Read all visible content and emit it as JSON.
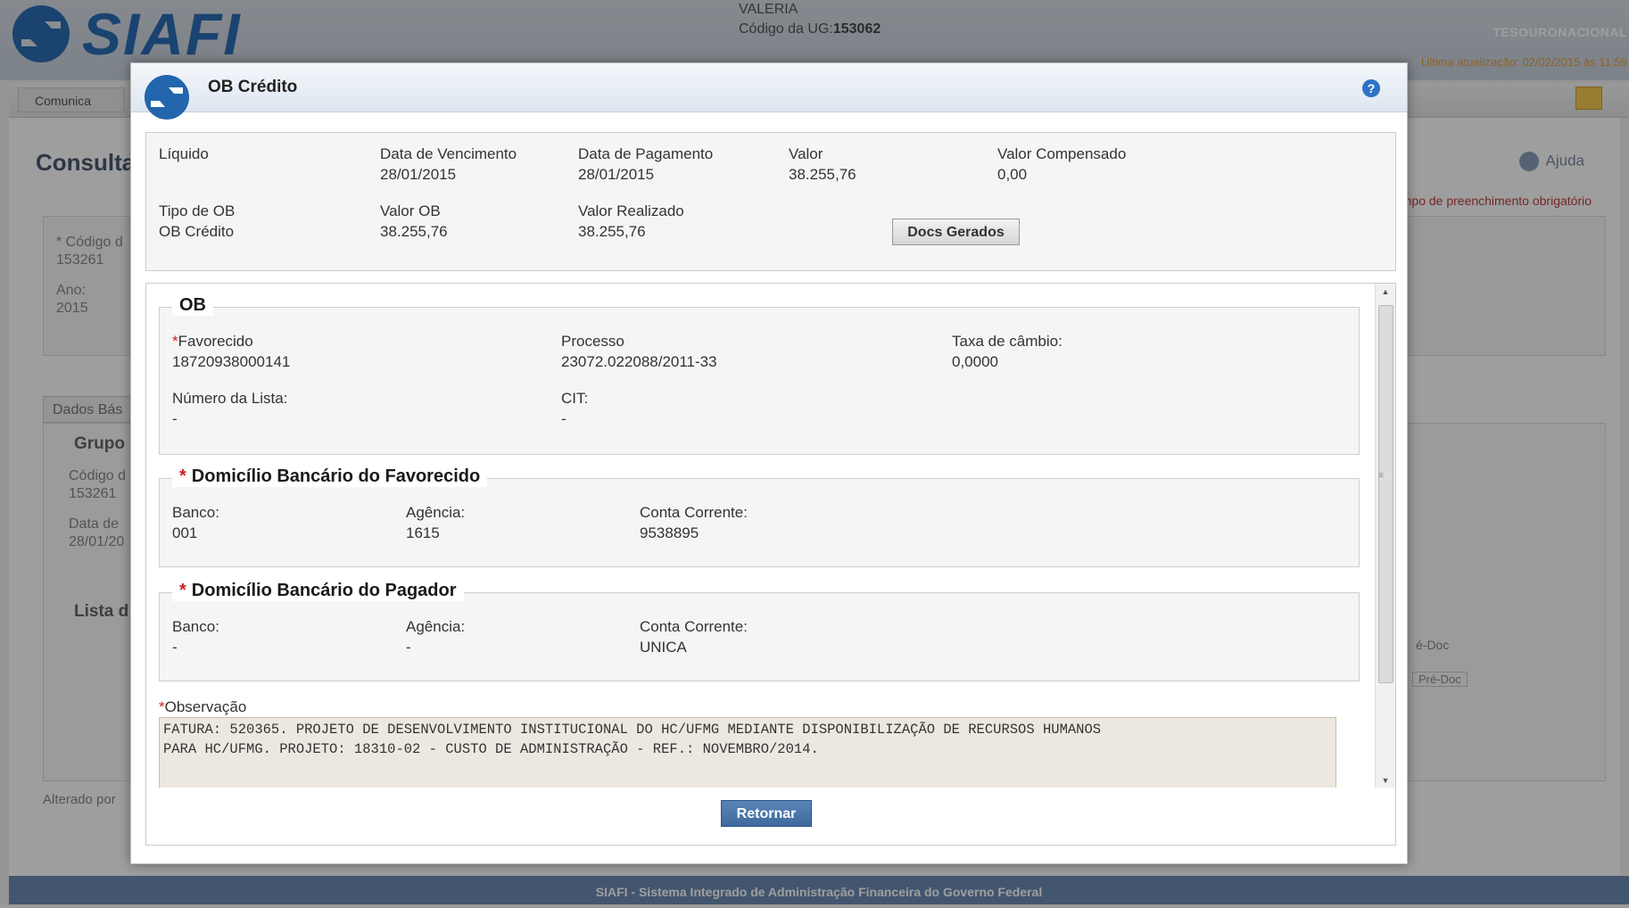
{
  "background": {
    "logo_text": "SIAFI",
    "user_name": "VALERIA",
    "ug_label": "Código da UG:",
    "ug_value": "153062",
    "tesouro": "TESOURONACIONAL",
    "last_update": "Última atualização: 02/02/2015 às 11:59",
    "tab_comunica": "Comunica",
    "page_title": "Consulta",
    "help_label": "Ajuda",
    "required_note": "Campo de preenchimento obrigatório",
    "codigo_label": "* Código d",
    "codigo_value": "153261",
    "ano_label": "Ano:",
    "ano_value": "2015",
    "tab_dados": "Dados Bás",
    "grupo_title": "Grupo",
    "grupo_codigo_label": "Código d",
    "grupo_codigo_value": "153261",
    "data_label": "Data de",
    "data_value": "28/01/20",
    "lista_title": "Lista d",
    "pre_doc_header": "é-Doc",
    "pre_doc_btn": "Pré-Doc",
    "alterado_por": "Alterado por",
    "footer": "SIAFI - Sistema Integrado de Administração Financeira do Governo Federal"
  },
  "modal": {
    "title": "OB Crédito",
    "help_icon_glyph": "?",
    "summary": {
      "liquido_label": "Líquido",
      "vencimento_label": "Data de Vencimento",
      "vencimento_value": "28/01/2015",
      "pagamento_label": "Data de Pagamento",
      "pagamento_value": "28/01/2015",
      "valor_label": "Valor",
      "valor_value": "38.255,76",
      "compensado_label": "Valor Compensado",
      "compensado_value": "0,00",
      "tipo_label": "Tipo de OB",
      "tipo_value": "OB Crédito",
      "valor_ob_label": "Valor OB",
      "valor_ob_value": "38.255,76",
      "realizado_label": "Valor Realizado",
      "realizado_value": "38.255,76",
      "docs_button": "Docs Gerados"
    },
    "ob": {
      "legend": "OB",
      "favorecido_label": "Favorecido",
      "favorecido_value": "18720938000141",
      "processo_label": "Processo",
      "processo_value": "23072.022088/2011-33",
      "taxa_label": "Taxa de câmbio:",
      "taxa_value": "0,0000",
      "lista_label": "Número da Lista:",
      "lista_value": "-",
      "cit_label": "CIT:",
      "cit_value": "-"
    },
    "favorecido_bank": {
      "legend": "Domicílio Bancário do Favorecido",
      "banco_label": "Banco:",
      "banco_value": "001",
      "agencia_label": "Agência:",
      "agencia_value": "1615",
      "conta_label": "Conta Corrente:",
      "conta_value": "9538895"
    },
    "pagador_bank": {
      "legend": "Domicílio Bancário do Pagador",
      "banco_label": "Banco:",
      "banco_value": "-",
      "agencia_label": "Agência:",
      "agencia_value": "-",
      "conta_label": "Conta Corrente:",
      "conta_value": "UNICA"
    },
    "observacao_label": "Observação",
    "observacao_value": "FATURA: 520365. PROJETO DE DESENVOLVIMENTO INSTITUCIONAL DO HC/UFMG MEDIANTE DISPONIBILIZAÇÃO DE RECURSOS HUMANOS\nPARA HC/UFMG. PROJETO: 18310-02 - CUSTO DE ADMINISTRAÇÃO - REF.: NOVEMBRO/2014.",
    "return_button": "Retornar"
  },
  "colors": {
    "accent": "#2f72c4",
    "required": "#d02020",
    "footer_bg": "#6c8cb4",
    "return_btn": "#3e6a9e"
  }
}
